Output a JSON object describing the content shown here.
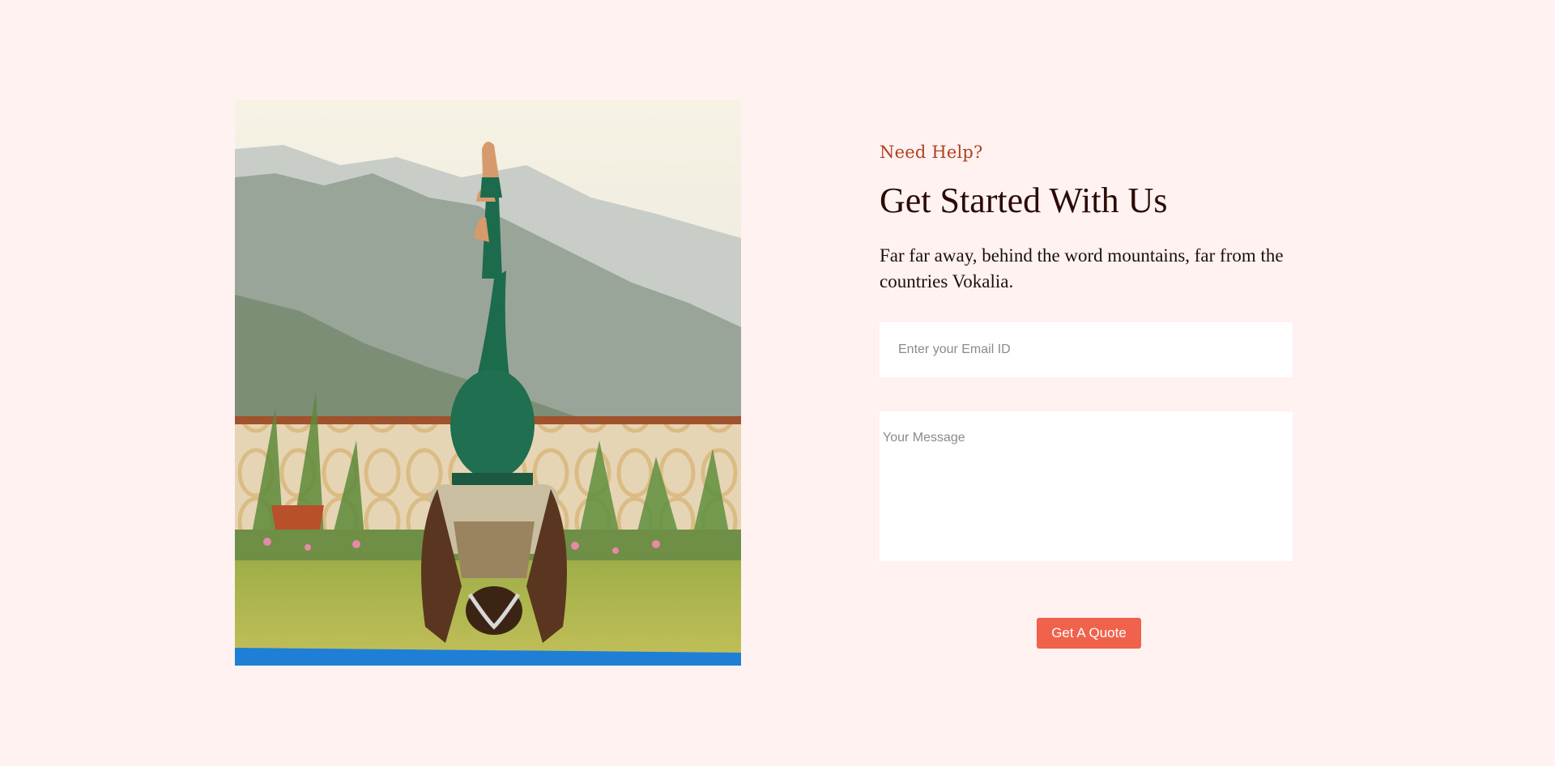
{
  "hero": {
    "image_description": "Woman in a yoga headstand",
    "image_alt": "Yoga headstand in a garden with mountains behind"
  },
  "contact": {
    "eyebrow": "Need Help?",
    "title": "Get Started With Us",
    "description": "Far far away, behind the word mountains, far from the countries Vokalia.",
    "email_placeholder": "Enter your Email ID",
    "message_placeholder": "Your Message",
    "submit_label": "Get A Quote"
  },
  "colors": {
    "page_background": "#fff2f1",
    "accent": "#f0624b",
    "eyebrow": "#b3401f",
    "title": "#2b0a06"
  }
}
